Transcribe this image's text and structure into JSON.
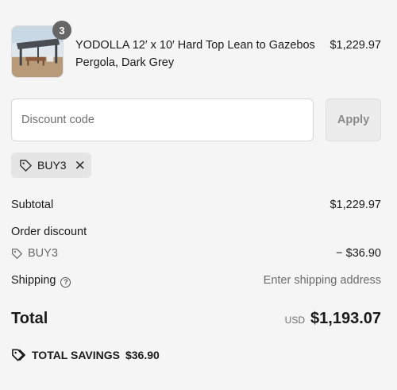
{
  "product": {
    "quantity": "3",
    "name": "YODOLLA 12′ x 10′ Hard Top Lean to Gazebos Pergola, Dark Grey",
    "price": "$1,229.97"
  },
  "discount": {
    "placeholder": "Discount code",
    "apply_label": "Apply",
    "applied_code": "BUY3"
  },
  "summary": {
    "subtotal_label": "Subtotal",
    "subtotal_value": "$1,229.97",
    "order_discount_label": "Order discount",
    "discount_code": "BUY3",
    "discount_value": "− $36.90",
    "shipping_label": "Shipping",
    "shipping_value": "Enter shipping address",
    "total_label": "Total",
    "currency": "USD",
    "total_value": "$1,193.07",
    "savings_label": "TOTAL SAVINGS",
    "savings_value": "$36.90"
  },
  "icons": {
    "tag": "tag-icon",
    "close": "close-icon",
    "help": "question-circle-icon",
    "savings": "tag-icon"
  },
  "colors": {
    "background": "#f5f5f5",
    "badge": "#666666",
    "apply_disabled_text": "#8a8a8a"
  }
}
